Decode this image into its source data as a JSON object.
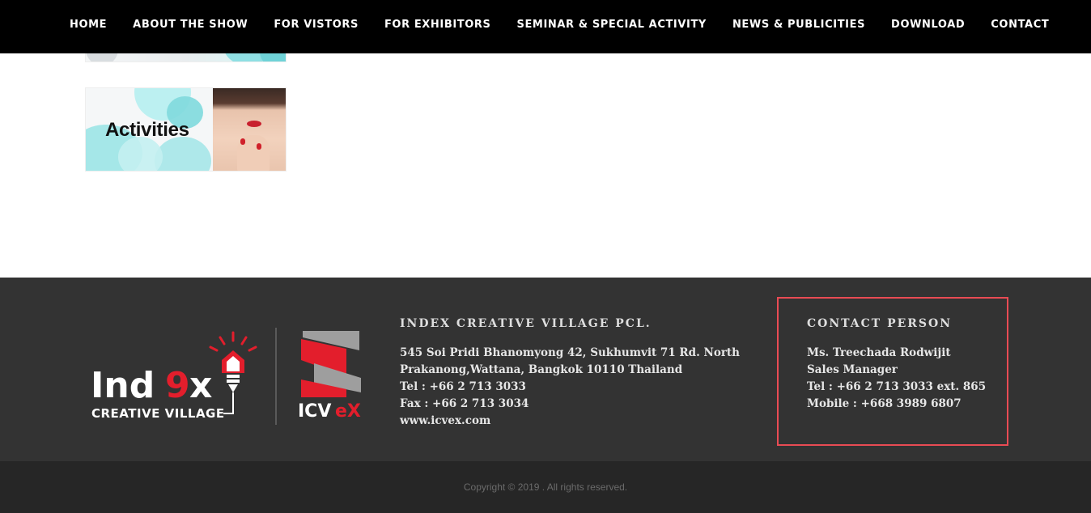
{
  "nav": {
    "items": [
      {
        "label": "HOME"
      },
      {
        "label": "ABOUT THE SHOW"
      },
      {
        "label": "FOR VISTORS"
      },
      {
        "label": "FOR EXHIBITORS"
      },
      {
        "label": "SEMINAR & SPECIAL ACTIVITY"
      },
      {
        "label": "NEWS & PUBLICITIES"
      },
      {
        "label": "DOWNLOAD"
      },
      {
        "label": "CONTACT"
      }
    ]
  },
  "main": {
    "activities_banner": {
      "title": "Activities"
    }
  },
  "footer": {
    "logos": {
      "index_main": "Ind",
      "index_accent": "9",
      "index_end": "x",
      "index_sub": "CREATIVE VILLAGE",
      "icvex_main": "ICV",
      "icvex_accent": "eX"
    },
    "company": {
      "title": "INDEX CREATIVE VILLAGE PCL.",
      "address_1": "545 Soi Pridi Bhanomyong 42, Sukhumvit 71 Rd. North",
      "address_2": "Prakanong,Wattana, Bangkok 10110 Thailand",
      "tel": "Tel : +66 2 713 3033",
      "fax": "Fax : +66 2 713 3034",
      "web": "www.icvex.com"
    },
    "contact": {
      "title": "CONTACT PERSON",
      "name": "Ms. Treechada Rodwijit",
      "position": "Sales Manager",
      "tel": "Tel : +66 2 713 3033 ext. 865",
      "mobile": "Mobile : +668 3989 6807"
    },
    "copyright": "Copyright © 2019 . All rights reserved."
  },
  "colors": {
    "nav_bg": "#000000",
    "footer_bg": "#333333",
    "copyright_bg": "#262626",
    "accent_red": "#e31e2c",
    "highlight_border": "#e94b54"
  }
}
